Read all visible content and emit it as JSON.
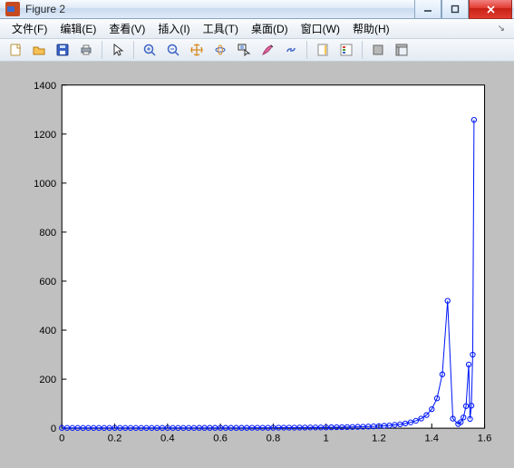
{
  "window": {
    "title": "Figure 2",
    "controls": {
      "minimize": "–",
      "maximize": "□",
      "close": "✕"
    }
  },
  "menu": {
    "items": [
      {
        "id": "file",
        "label": "文件(F)"
      },
      {
        "id": "edit",
        "label": "编辑(E)"
      },
      {
        "id": "view",
        "label": "查看(V)"
      },
      {
        "id": "insert",
        "label": "插入(I)"
      },
      {
        "id": "tools",
        "label": "工具(T)"
      },
      {
        "id": "desktop",
        "label": "桌面(D)"
      },
      {
        "id": "window",
        "label": "窗口(W)"
      },
      {
        "id": "help",
        "label": "帮助(H)"
      }
    ],
    "dock_glyph": "↘"
  },
  "toolbar": {
    "buttons": [
      {
        "id": "new",
        "name": "new-figure-icon"
      },
      {
        "id": "open",
        "name": "open-icon"
      },
      {
        "id": "save",
        "name": "save-icon"
      },
      {
        "id": "print",
        "name": "print-icon"
      },
      {
        "sep": true
      },
      {
        "id": "pointer",
        "name": "pointer-icon"
      },
      {
        "sep": true
      },
      {
        "id": "zoomin",
        "name": "zoom-in-icon"
      },
      {
        "id": "zoomout",
        "name": "zoom-out-icon"
      },
      {
        "id": "pan",
        "name": "pan-icon"
      },
      {
        "id": "rotate",
        "name": "rotate3d-icon"
      },
      {
        "id": "datacursor",
        "name": "data-cursor-icon"
      },
      {
        "id": "brush",
        "name": "brush-icon"
      },
      {
        "id": "link",
        "name": "link-icon"
      },
      {
        "sep": true
      },
      {
        "id": "colorbar",
        "name": "colorbar-icon"
      },
      {
        "id": "legend",
        "name": "legend-icon"
      },
      {
        "sep": true
      },
      {
        "id": "hide",
        "name": "hide-plot-tools-icon"
      },
      {
        "id": "show",
        "name": "show-plot-tools-icon"
      }
    ]
  },
  "chart_data": {
    "type": "line",
    "title": "",
    "xlabel": "",
    "ylabel": "",
    "xlim": [
      0,
      1.6
    ],
    "ylim": [
      0,
      1400
    ],
    "xticks": [
      0,
      0.2,
      0.4,
      0.6,
      0.8,
      1,
      1.2,
      1.4,
      1.6
    ],
    "yticks": [
      0,
      200,
      400,
      600,
      800,
      1000,
      1200,
      1400
    ],
    "marker": "o",
    "color": "#0018f9",
    "x": [
      0.0,
      0.02,
      0.04,
      0.06,
      0.08,
      0.1,
      0.12,
      0.14,
      0.16,
      0.18,
      0.2,
      0.22,
      0.24,
      0.26,
      0.28,
      0.3,
      0.32,
      0.34,
      0.36,
      0.38,
      0.4,
      0.42,
      0.44,
      0.46,
      0.48,
      0.5,
      0.52,
      0.54,
      0.56,
      0.58,
      0.6,
      0.62,
      0.64,
      0.66,
      0.68,
      0.7,
      0.72,
      0.74,
      0.76,
      0.78,
      0.8,
      0.82,
      0.84,
      0.86,
      0.88,
      0.9,
      0.92,
      0.94,
      0.96,
      0.98,
      1.0,
      1.02,
      1.04,
      1.06,
      1.08,
      1.1,
      1.12,
      1.14,
      1.16,
      1.18,
      1.2,
      1.22,
      1.24,
      1.26,
      1.28,
      1.3,
      1.32,
      1.34,
      1.36,
      1.38,
      1.4,
      1.42,
      1.44,
      1.46,
      1.48,
      1.5,
      1.51,
      1.52,
      1.53,
      1.54,
      1.545,
      1.55,
      1.555,
      1.56
    ],
    "y": [
      1.0,
      1.0,
      1.0,
      1.0,
      1.0,
      1.0,
      1.0,
      1.0,
      1.0,
      1.1,
      1.1,
      1.1,
      1.1,
      1.1,
      1.1,
      1.1,
      1.1,
      1.2,
      1.2,
      1.2,
      1.2,
      1.2,
      1.3,
      1.3,
      1.3,
      1.3,
      1.4,
      1.4,
      1.4,
      1.5,
      1.5,
      1.5,
      1.6,
      1.6,
      1.7,
      1.7,
      1.8,
      1.8,
      1.9,
      2.0,
      2.0,
      2.1,
      2.2,
      2.3,
      2.4,
      2.6,
      2.7,
      2.9,
      3.0,
      3.2,
      3.5,
      3.7,
      4.0,
      4.3,
      4.7,
      5.1,
      5.6,
      6.2,
      6.9,
      7.7,
      8.7,
      10.0,
      11.5,
      13.5,
      16.0,
      19.3,
      23.8,
      30.1,
      39.3,
      53.6,
      77.5,
      122,
      220,
      520,
      39,
      17,
      25,
      44,
      90,
      260,
      38,
      92,
      300,
      1258
    ]
  }
}
